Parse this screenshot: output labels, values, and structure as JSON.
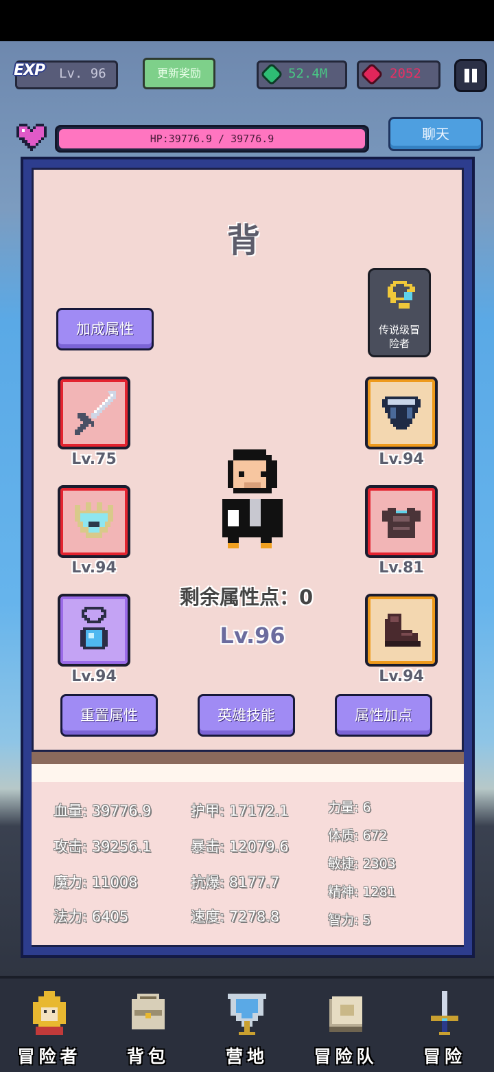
{
  "hud": {
    "exp_label": "EXP",
    "level": "Lv. 96",
    "refresh_button": "更新奖励",
    "gems": "52.4M",
    "rubies": "2052",
    "hp_text": "HP:39776.9 / 39776.9",
    "hp_fraction": 1.0,
    "chat_button": "聊天"
  },
  "panel": {
    "title": "背",
    "bonus_button": "加成属性",
    "legend_badge": "传说级冒险者",
    "remaining_points": "剩余属性点：0",
    "hero_level": "Lv.96",
    "equipment": [
      {
        "slot": "sword",
        "icon": "sword-icon",
        "level": "Lv.75",
        "rarity": "red"
      },
      {
        "slot": "helmet",
        "icon": "crown-helmet-icon",
        "level": "Lv.94",
        "rarity": "red"
      },
      {
        "slot": "necklace",
        "icon": "necklace-icon",
        "level": "Lv.94",
        "rarity": "purple"
      },
      {
        "slot": "gem",
        "icon": "dark-gem-icon",
        "level": "Lv.94",
        "rarity": "gold"
      },
      {
        "slot": "armor",
        "icon": "armor-icon",
        "level": "Lv.81",
        "rarity": "red"
      },
      {
        "slot": "boots",
        "icon": "boots-icon",
        "level": "Lv.94",
        "rarity": "gold"
      }
    ],
    "buttons": {
      "reset": "重置属性",
      "skills": "英雄技能",
      "add_points": "属性加点"
    }
  },
  "stats": {
    "col1": [
      "血量: 39776.9",
      "攻击: 39256.1",
      "魔力: 11008",
      "法力: 6405"
    ],
    "col2": [
      "护甲: 17172.1",
      "暴击: 12079.6",
      "抗爆: 8177.7",
      "速度: 7278.8"
    ],
    "col3": [
      "力量: 6",
      "体质: 672",
      "敏捷: 2303",
      "精神: 1281",
      "智力: 5"
    ]
  },
  "nav": [
    {
      "label": "冒险者",
      "icon": "golden-helmet-icon"
    },
    {
      "label": "背包",
      "icon": "backpack-icon"
    },
    {
      "label": "营地",
      "icon": "banner-icon"
    },
    {
      "label": "冒险队",
      "icon": "book-icon"
    },
    {
      "label": "冒险",
      "icon": "sword-hilt-icon"
    }
  ],
  "colors": {
    "panel_bg": "#f3d8d4",
    "panel_border": "#2d3d8e",
    "hp_fill": "#ff75c0",
    "button_purple": "#a08bf4",
    "gem_green": "#49c785",
    "ruby_red": "#ea2e63"
  }
}
